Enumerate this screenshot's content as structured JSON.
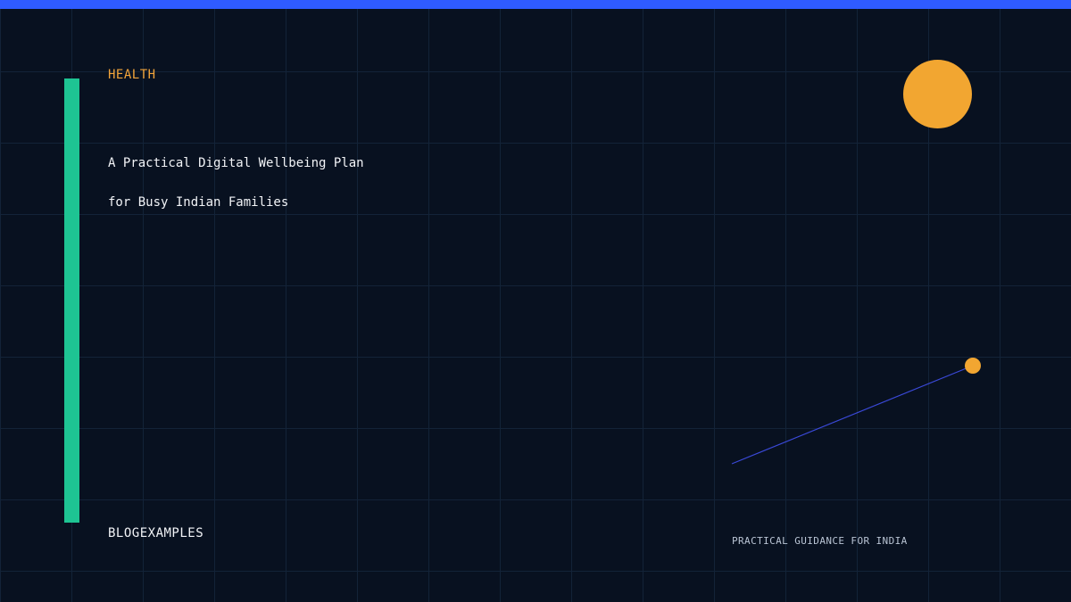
{
  "header": {
    "category": "HEALTH"
  },
  "article": {
    "title_line_1": "A Practical Digital Wellbeing Plan",
    "title_line_2": "for Busy Indian Families"
  },
  "footer": {
    "brand": "BLOGEXAMPLES",
    "tagline": "PRACTICAL GUIDANCE FOR INDIA"
  },
  "colors": {
    "top_bar": "#2f5bff",
    "accent_bar": "#1ec493",
    "category_text": "#f2a43a",
    "sun": "#f2a631",
    "line": "#3a49d8",
    "line_dot": "#f2a631"
  }
}
